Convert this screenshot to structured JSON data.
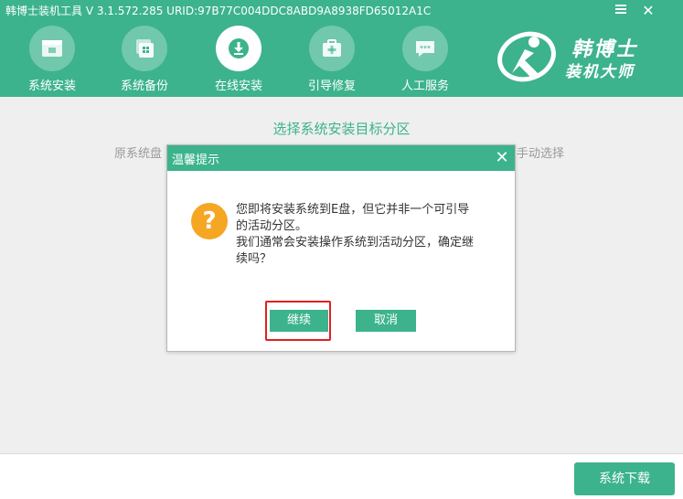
{
  "window": {
    "title": "韩博士装机工具 V 3.1.572.285 URID:97B77C004DDC8ABD9A8938FD65012A1C",
    "minimize_icon": "minimize-icon",
    "close_icon": "close-icon"
  },
  "nav": {
    "items": [
      {
        "label": "系统安装",
        "icon": "system-install-icon",
        "active": false
      },
      {
        "label": "系统备份",
        "icon": "system-backup-icon",
        "active": false
      },
      {
        "label": "在线安装",
        "icon": "online-install-icon",
        "active": true
      },
      {
        "label": "引导修复",
        "icon": "boot-repair-icon",
        "active": false
      },
      {
        "label": "人工服务",
        "icon": "customer-service-icon",
        "active": false
      }
    ]
  },
  "logo": {
    "line1": "韩博士",
    "line2": "装机大师"
  },
  "main": {
    "title": "选择系统安装目标分区",
    "desc_left": "原系统盘",
    "desc_right": "手动选择"
  },
  "dialog": {
    "title": "温馨提示",
    "icon": "question-icon",
    "message_lines": [
      "您即将安装系统到E盘，但它并非一个可引导",
      "的活动分区。",
      "我们通常会安装操作系统到活动分区，确定继",
      "续吗？"
    ],
    "continue_label": "继续",
    "cancel_label": "取消"
  },
  "footer": {
    "download_label": "系统下载"
  },
  "colors": {
    "brand": "#3cb38c",
    "warning": "#f5a623",
    "highlight": "#e02020"
  }
}
